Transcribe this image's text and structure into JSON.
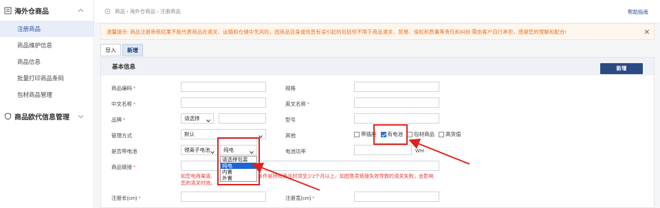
{
  "sidebar": {
    "group1": {
      "label": "海外仓商品"
    },
    "items": [
      {
        "label": "注册商品"
      },
      {
        "label": "商品维护信息"
      },
      {
        "label": "商品信息"
      },
      {
        "label": "批量打印商品条码"
      },
      {
        "label": "包材商品管理"
      }
    ],
    "group2": {
      "label": "商品欧代信息管理"
    }
  },
  "breadcrumb": {
    "text": "商品 › 海外仓商品 › 注册商品"
  },
  "help": {
    "label": "帮助指南"
  },
  "warning": {
    "text": "温馨提示: 商品注册审核结果不能代表商品在通关、运输和仓储中无风险，因商品自身或信息有误引起的包括但不限于商品通关、贸易、侵权和质量等责任和纠纷 需由客户自行承担，感谢您的理解和配合!"
  },
  "tabs": [
    {
      "label": "导入"
    },
    {
      "label": "新增"
    }
  ],
  "panel": {
    "title": "基本信息",
    "add_label": "新增"
  },
  "form": {
    "sku": {
      "label": "商品编码"
    },
    "spec": {
      "label": "规格"
    },
    "cn_name": {
      "label": "中文名称"
    },
    "en_name": {
      "label": "英文名称"
    },
    "brand": {
      "label": "品牌",
      "value": "请选择"
    },
    "model": {
      "label": "型号"
    },
    "manage": {
      "label": "管理方式",
      "value": "默认"
    },
    "other": {
      "label": "其他",
      "options": [
        "带插座",
        "有电池",
        "包材商品",
        "高货值"
      ],
      "checked": "有电池"
    },
    "battery": {
      "label": "是否带电池",
      "type_value": "锂离子电池",
      "value": "纯电"
    },
    "power": {
      "label": "电池功率",
      "unit": "WH"
    },
    "link": {
      "label": "商品链接"
    },
    "hint": {
      "line1": "如您电商渠道,",
      "line1b": "条件是持有商品时须至少2个月以上，如因售卖链接失效导致的清关失败，会影响",
      "line2": "您的清关时效。"
    },
    "length": {
      "label": "注册长(cm)"
    },
    "width": {
      "label": "注册宽(cm)"
    },
    "dropdown": [
      "请选择包装",
      "纯电",
      "内置",
      "外置"
    ]
  },
  "colors": {
    "accent": "#2b4a83",
    "warn": "#e8711a",
    "annotation": "#e0201c"
  }
}
